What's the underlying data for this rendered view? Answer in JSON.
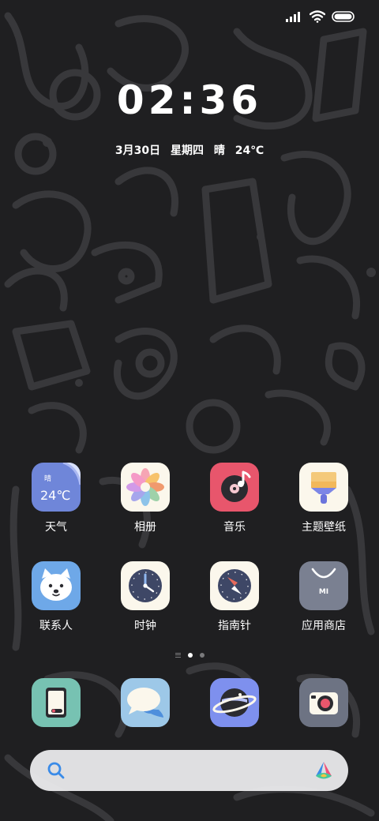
{
  "clock": {
    "time": "02:36"
  },
  "date": {
    "day": "3月30日",
    "weekday": "星期四",
    "weather": "晴",
    "temperature": "24℃"
  },
  "home_apps": [
    {
      "label": "天气",
      "icon": "weather-icon",
      "tile_text_top": "晴",
      "tile_text_main": "24℃",
      "color": "#6f86d9"
    },
    {
      "label": "相册",
      "icon": "gallery-icon",
      "color": "#fbf7ec"
    },
    {
      "label": "音乐",
      "icon": "music-icon",
      "color": "#e8566c"
    },
    {
      "label": "主题壁纸",
      "icon": "themes-icon",
      "color": "#fbf7ec"
    },
    {
      "label": "联系人",
      "icon": "contacts-icon",
      "color": "#6ea8e8"
    },
    {
      "label": "时钟",
      "icon": "clock-icon",
      "color": "#fbf7ec"
    },
    {
      "label": "指南针",
      "icon": "compass-icon",
      "color": "#fbf7ec"
    },
    {
      "label": "应用商店",
      "icon": "app-store-icon",
      "tile_text": "MI",
      "color": "#7a8091"
    }
  ],
  "dock_apps": [
    {
      "name": "phone-app",
      "icon": "phone-icon",
      "color": "#77c2b2"
    },
    {
      "name": "messages-app",
      "icon": "messages-icon",
      "color": "#9dc8e8"
    },
    {
      "name": "browser-app",
      "icon": "browser-icon",
      "color": "#7e90ee"
    },
    {
      "name": "camera-app",
      "icon": "camera-icon",
      "color": "#6d7383"
    }
  ],
  "page_indicator": {
    "pages": 2,
    "current": 1
  }
}
